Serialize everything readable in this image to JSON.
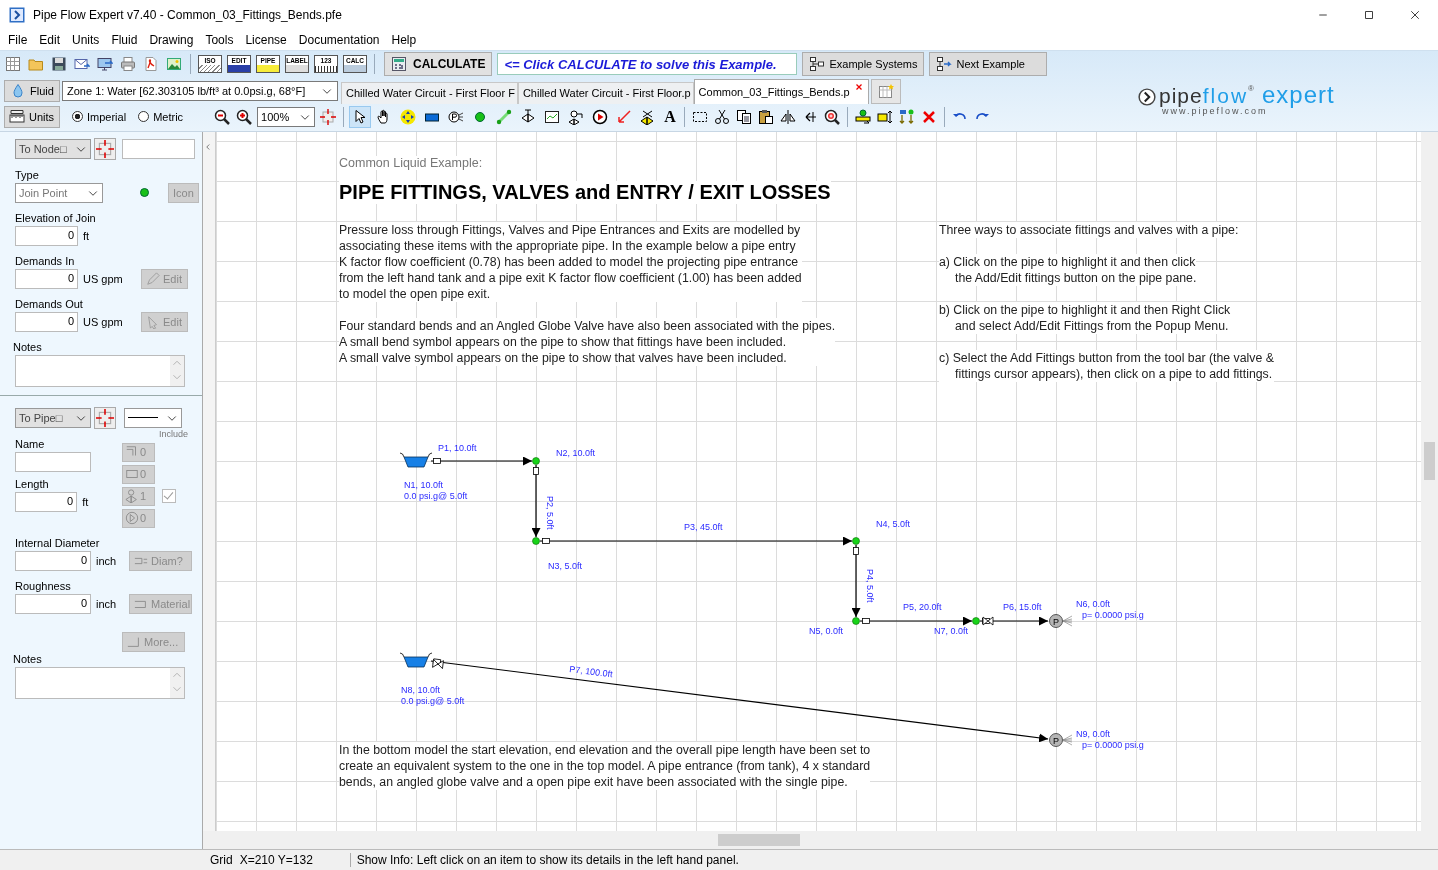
{
  "window": {
    "title": "Pipe Flow Expert v7.40 - Common_03_Fittings_Bends.pfe"
  },
  "menu": [
    "File",
    "Edit",
    "Units",
    "Fluid",
    "Drawing",
    "Tools",
    "License",
    "Documentation",
    "Help"
  ],
  "toolbar": {
    "tool_labels": [
      "ISO",
      "EDIT",
      "PIPE",
      "LABEL",
      "123",
      "CALC"
    ],
    "calculate": "CALCULATE",
    "hint": "<= Click CALCULATE to solve this Example.",
    "example_systems": "Example Systems",
    "next_example": "Next Example"
  },
  "fluid_bar": {
    "fluid_button": "Fluid",
    "zone": "Zone 1: Water [62.303105 lb/ft³ at 0.0psi.g, 68°F]"
  },
  "document_tabs": [
    {
      "label": "Chilled Water Circuit - First Floor F",
      "selected": false
    },
    {
      "label": "Chilled Water Circuit - First Floor.p",
      "selected": false
    },
    {
      "label": "Common_03_Fittings_Bends.p",
      "selected": true
    }
  ],
  "units_bar": {
    "units_button": "Units",
    "unit_systems": [
      {
        "label": "Imperial",
        "selected": true
      },
      {
        "label": "Metric",
        "selected": false
      }
    ],
    "zoom": "100%",
    "text_tool": "A"
  },
  "drawing_tools": [
    {
      "selected": true
    },
    {
      "selected": false
    },
    {
      "selected": false
    },
    {
      "selected": false
    },
    {
      "selected": false
    },
    {
      "selected": false
    },
    {
      "selected": false
    },
    {
      "selected": false
    },
    {
      "selected": false
    },
    {
      "selected": false
    },
    {
      "selected": false
    },
    {
      "selected": false
    },
    {
      "selected": false
    }
  ],
  "logo": {
    "word1": "pipe",
    "word2": "flow",
    "mark": "®",
    "word3": "expert",
    "url": "www.pipeflow.com"
  },
  "node_panel": {
    "selector": "To Node□",
    "type_label": "Type",
    "type_value": "Join Point",
    "icon_button": "Icon",
    "controls_disabled": true,
    "elevation": {
      "label": "Elevation of Join",
      "value": "0",
      "unit": "ft"
    },
    "demands_in": {
      "label": "Demands In",
      "value": "0",
      "unit": "US gpm",
      "button": "Edit"
    },
    "demands_out": {
      "label": "Demands Out",
      "value": "0",
      "unit": "US gpm",
      "button": "Edit"
    },
    "notes_label": "Notes"
  },
  "pipe_panel": {
    "selector": "To Pipe□",
    "name_label": "Name",
    "include_label": "Include",
    "fitting_counts": [
      "0",
      "0",
      "1",
      "0"
    ],
    "include_checked": true,
    "controls_disabled": true,
    "length": {
      "label": "Length",
      "value": "0",
      "unit": "ft"
    },
    "internal_diameter": {
      "label": "Internal Diameter",
      "value": "0",
      "unit": "inch",
      "button": "Diam?"
    },
    "roughness": {
      "label": "Roughness",
      "value": "0",
      "unit": "inch",
      "button": "Material"
    },
    "more_button": "More...",
    "notes_label": "Notes"
  },
  "canvas": {
    "subtitle": "Common Liquid Example:",
    "title": "PIPE FITTINGS, VALVES and ENTRY / EXIT LOSSES",
    "left_paragraphs": [
      [
        "Pressure loss through Fittings, Valves and Pipe Entrances and Exits are modelled by",
        "associating these items with the appropriate pipe. In the example below a pipe entry",
        "K factor flow coefficient (0.78) has been added to model the projecting pipe entrance",
        "from the left hand tank and a pipe exit K factor flow coefficient (1.00) has been added",
        "to model the open pipe exit."
      ],
      [
        "Four standard bends and an Angled Globe Valve have also been associated with the pipes.",
        "A small bend symbol appears on the pipe to show that fittings have been included.",
        "A small valve symbol appears on the pipe to show that valves have been included."
      ]
    ],
    "right_intro": "Three ways to associate fittings and valves with a pipe:",
    "right_items": [
      [
        "a) Click on the pipe to highlight it and then click",
        "the Add/Edit fittings button on the pipe pane."
      ],
      [
        "b) Click on the pipe to highlight it and then Right Click",
        "and select Add/Edit Fittings from the Popup Menu."
      ],
      [
        "c) Select the Add Fittings button from the tool bar (the valve &",
        "fittings cursor appears), then click on a pipe to add fittings."
      ]
    ],
    "bottom_paragraph": [
      "In the bottom model the start elevation, end elevation and the overall pipe length have been set to",
      "create an equivalent system to the one in the top model. A pipe entrance (from tank), 4 x standard",
      "bends, an angled globe valve and a open pipe exit have been associated with the single pipe."
    ]
  },
  "diagram": {
    "nodes": [
      {
        "kind": "tank",
        "labels": [
          "N1, 10.0ft",
          "0.0 psi.g@ 5.0ft"
        ]
      },
      {
        "kind": "join",
        "labels": [
          "N2, 10.0ft"
        ]
      },
      {
        "kind": "join",
        "labels": [
          "N3, 5.0ft"
        ]
      },
      {
        "kind": "join",
        "labels": [
          "N4, 5.0ft"
        ]
      },
      {
        "kind": "join",
        "labels": [
          "N5, 0.0ft"
        ]
      },
      {
        "kind": "pressure",
        "symbol": "P",
        "labels": [
          "N6, 0.0ft",
          "p= 0.0000 psi.g"
        ]
      },
      {
        "kind": "join",
        "labels": [
          "N7, 0.0ft"
        ]
      },
      {
        "kind": "tank",
        "labels": [
          "N8, 10.0ft",
          "0.0 psi.g@ 5.0ft"
        ]
      },
      {
        "kind": "pressure",
        "symbol": "P",
        "labels": [
          "N9, 0.0ft",
          "p= 0.0000 psi.g"
        ]
      }
    ],
    "pipes": [
      {
        "label": "P1, 10.0ft",
        "valve": false
      },
      {
        "label": "P2, 5.0ft",
        "valve": false
      },
      {
        "label": "P3, 45.0ft",
        "valve": false
      },
      {
        "label": "P4, 5.0ft",
        "valve": false
      },
      {
        "label": "P5, 20.0ft",
        "valve": false
      },
      {
        "label": "P6, 15.0ft",
        "valve": true
      },
      {
        "label": "P7, 100.0ft",
        "valve": true
      }
    ]
  },
  "status_bar": {
    "grid": "Grid",
    "coords": "X=210  Y=132",
    "info": "Show Info: Left click on an item to show its details in the left hand panel."
  }
}
